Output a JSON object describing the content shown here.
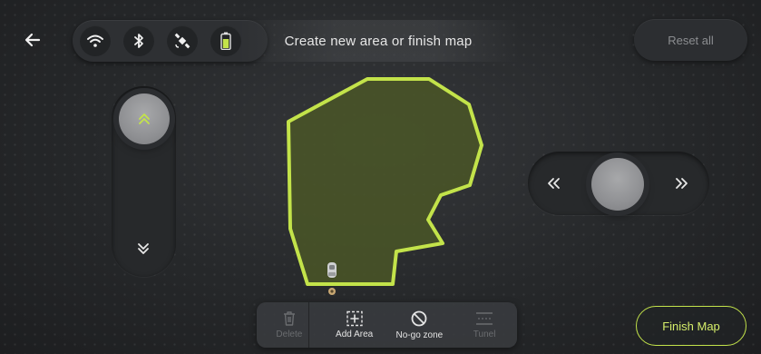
{
  "header": {
    "prompt": "Create new area or finish map",
    "reset_label": "Reset all"
  },
  "status_icons": [
    "wifi-icon",
    "bluetooth-icon",
    "satellite-icon",
    "battery-icon"
  ],
  "toolbar": {
    "items": [
      {
        "label": "Delete",
        "icon": "trash-icon",
        "enabled": false
      },
      {
        "label": "Add Area",
        "icon": "add-area-icon",
        "enabled": true
      },
      {
        "label": "No-go zone",
        "icon": "no-go-icon",
        "enabled": true
      },
      {
        "label": "Tunel",
        "icon": "tunnel-icon",
        "enabled": false
      }
    ]
  },
  "finish_label": "Finish Map",
  "colors": {
    "accent": "#c3e34a",
    "area_fill": "#4a5627",
    "background": "#26282a"
  }
}
